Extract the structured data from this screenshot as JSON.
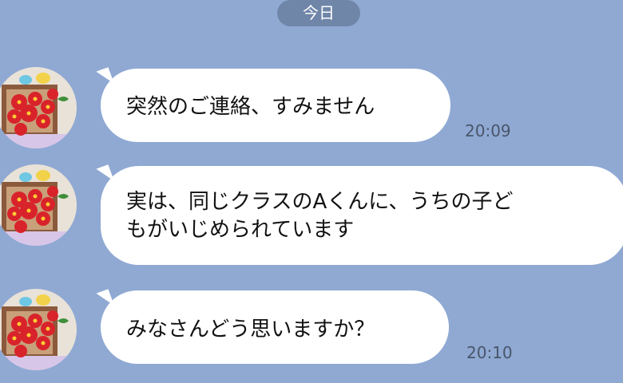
{
  "chat": {
    "date_label": "今日",
    "messages": [
      {
        "text": "突然のご連絡、すみません",
        "time": "20:09"
      },
      {
        "text": "実は、同じクラスのAくんに、うちの子ど\nもがいじめられています",
        "time": ""
      },
      {
        "text": "みなさんどう思いますか？",
        "time": "20:10"
      }
    ]
  },
  "avatar": {
    "icon": "flower-bouquet-avatar",
    "colors": {
      "flowers": "#d9232a",
      "bird_blue": "#6ec7e3",
      "bird_yellow": "#f2d24a",
      "wood": "#8b5a3c"
    }
  },
  "colors": {
    "background": "#8fa9d3",
    "bubble": "#ffffff",
    "date_pill": "#6f86a9",
    "time_text": "#4a566a"
  }
}
